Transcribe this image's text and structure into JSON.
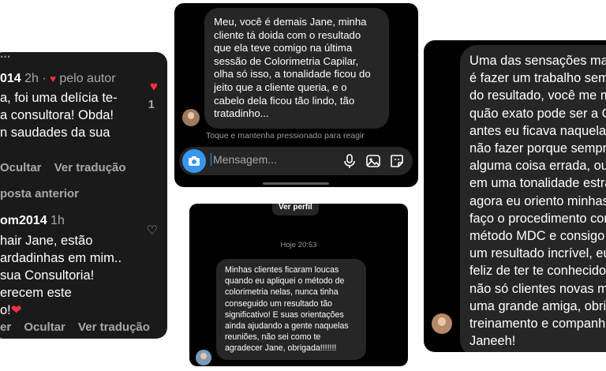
{
  "comments_card": {
    "cut_top": "...",
    "comment1": {
      "username": "014",
      "time": "2h",
      "separator": "·",
      "author_like": "pelo autor",
      "lines": [
        "a, foi uma delícia te-",
        "a consultora! Obda!",
        "n saudades da sua"
      ],
      "like_count": "1"
    },
    "actions1": [
      "Ocultar",
      "Ver tradução"
    ],
    "previous_replies": "posta anterior",
    "comment2": {
      "username": "om2014",
      "time": "1h",
      "lines": [
        "hair Jane, estão",
        "ardadinhas em mim..",
        "sua Consultoria!",
        "erecem este",
        "o!"
      ]
    },
    "actions2": [
      "er",
      "Ocultar",
      "Ver tradução"
    ]
  },
  "dm_top": {
    "message": "Meu, você é demais Jane, minha cliente tá doida com o resultado que ela teve comigo na última sessão de Colorimetria Capilar, olha só isso, a tonalidade ficou do jeito que a cliente queria, e o cabelo dela ficou tão lindo, tão tratadinho...",
    "hint": "Toque e mantenha pressionado para reagir",
    "composer_placeholder": "Mensagem...",
    "icons": [
      "camera-icon",
      "microphone-icon",
      "gallery-icon",
      "sticker-icon"
    ]
  },
  "dm_bottom": {
    "view_profile": "Ver perfil",
    "timestamp": "Hoje 20:53",
    "message": "Minhas clientes ficaram loucas quando eu apliquei o método de colorimetria nelas, nunca tinha conseguido um resultado tão significativo! E suas orientações ainda ajudando a gente naquelas reuniões, não sei como te agradecer Jane, obrigada!!!!!!!"
  },
  "dm_right": {
    "lines": [
      "Uma das sensações mai",
      "é fazer um trabalho sem",
      "do resultado, você me m",
      "quão exato pode ser a C",
      "antes eu ficava naquelas",
      "não fazer porque sempre",
      "alguma coisa errada, ou",
      "em uma tonalidade estra",
      "agora eu oriento minhas",
      "faço o procedimento com",
      "método MDC e consigo",
      "um resultado incrível, eu",
      "feliz de ter te conhecido",
      "não só clientes novas m",
      "uma grande amiga, obrig",
      "treinamento e companhe",
      "Janeeh!"
    ]
  },
  "colors": {
    "dark_bg": "#000000",
    "comment_bg": "#1a1a1a",
    "bubble": "#262626",
    "accent_blue": "#3797f0",
    "heart_red": "#ff3040",
    "muted": "#a8a8a8"
  }
}
